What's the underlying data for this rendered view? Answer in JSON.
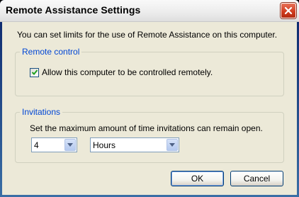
{
  "window": {
    "title": "Remote Assistance Settings"
  },
  "intro_text": "You can set limits for the use of Remote Assistance on this computer.",
  "remote_control": {
    "legend": "Remote control",
    "checkbox_label": "Allow this computer to be controlled remotely.",
    "checked": true
  },
  "invitations": {
    "legend": "Invitations",
    "description": "Set the maximum amount of time invitations can remain open.",
    "amount": "4",
    "unit": "Hours"
  },
  "buttons": {
    "ok": "OK",
    "cancel": "Cancel"
  },
  "colors": {
    "legend_text": "#0046d5",
    "close_button": "#cf3b1e",
    "dialog_bg": "#ece9d8"
  }
}
